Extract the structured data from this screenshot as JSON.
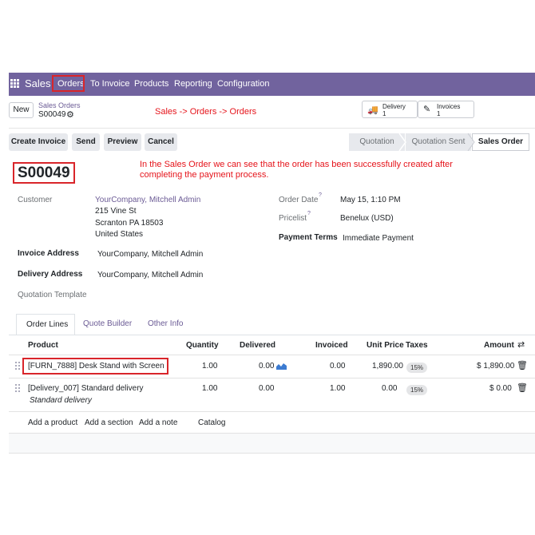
{
  "nav": {
    "brand": "Sales",
    "menu": [
      "Orders",
      "To Invoice",
      "Products",
      "Reporting",
      "Configuration"
    ]
  },
  "control": {
    "new_label": "New",
    "breadcrumb_parent": "Sales Orders",
    "breadcrumb_current": "S00049",
    "annotation": "Sales -> Orders -> Orders",
    "delivery_label": "Delivery",
    "delivery_count": "1",
    "invoices_label": "Invoices",
    "invoices_count": "1"
  },
  "actions": {
    "create_invoice": "Create Invoice",
    "send": "Send",
    "preview": "Preview",
    "cancel": "Cancel"
  },
  "status": [
    "Quotation",
    "Quotation Sent",
    "Sales Order"
  ],
  "annotation_note": "In the Sales Order we can see that the order has been successfully created after completing the payment process.",
  "order": {
    "name": "S00049",
    "customer_label": "Customer",
    "customer_name": "YourCompany, Mitchell Admin",
    "address_line1": "215 Vine St",
    "address_line2": "Scranton PA 18503",
    "address_line3": "United States",
    "invoice_address_label": "Invoice Address",
    "invoice_address": "YourCompany, Mitchell Admin",
    "delivery_address_label": "Delivery Address",
    "delivery_address": "YourCompany, Mitchell Admin",
    "quotation_template_label": "Quotation Template",
    "order_date_label": "Order Date",
    "order_date": "May 15, 1:10 PM",
    "pricelist_label": "Pricelist",
    "pricelist": "Benelux (USD)",
    "payment_terms_label": "Payment Terms",
    "payment_terms": "Immediate Payment"
  },
  "tabs": [
    "Order Lines",
    "Quote Builder",
    "Other Info"
  ],
  "table": {
    "headers": {
      "product": "Product",
      "quantity": "Quantity",
      "delivered": "Delivered",
      "invoiced": "Invoiced",
      "unit_price": "Unit Price",
      "taxes": "Taxes",
      "amount": "Amount"
    },
    "rows": [
      {
        "product": "[FURN_7888] Desk Stand with Screen",
        "quantity": "1.00",
        "delivered": "0.00",
        "invoiced": "0.00",
        "unit_price": "1,890.00",
        "tax": "15%",
        "amount": "$ 1,890.00"
      },
      {
        "product": "[Delivery_007] Standard delivery",
        "description": "Standard delivery",
        "quantity": "1.00",
        "delivered": "0.00",
        "invoiced": "1.00",
        "unit_price": "0.00",
        "tax": "15%",
        "amount": "$ 0.00"
      }
    ],
    "add_links": [
      "Add a product",
      "Add a section",
      "Add a note",
      "Catalog"
    ]
  },
  "colors": {
    "navbar": "#71639e",
    "accent_link": "#6b5b95",
    "annotation_red": "#e5141b"
  }
}
